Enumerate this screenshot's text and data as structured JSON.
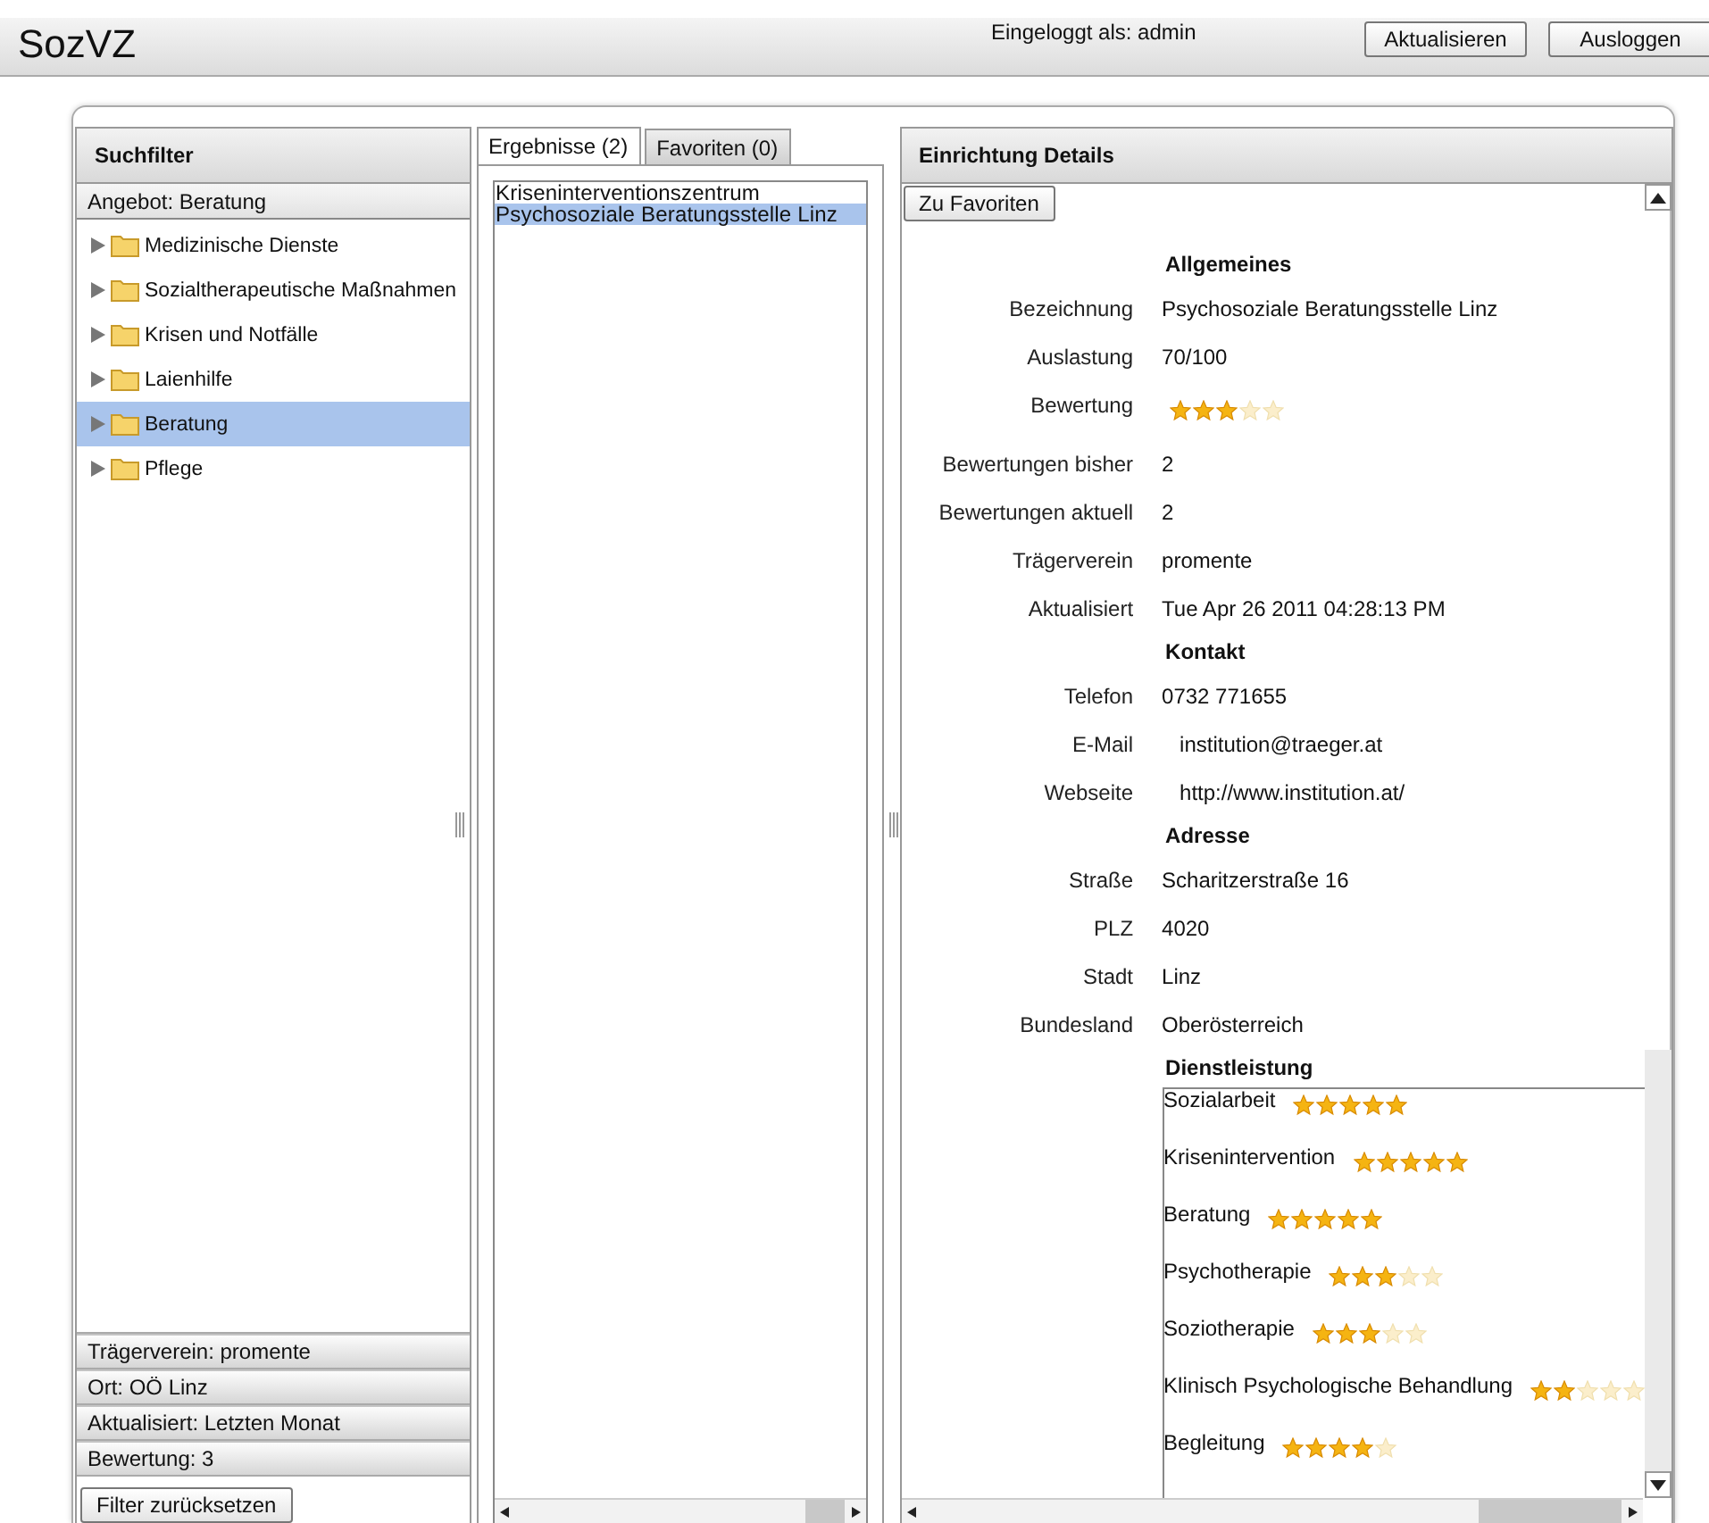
{
  "app": {
    "title": "SozVZ",
    "login_status": "Eingeloggt als: admin",
    "buttons": [
      {
        "label": "Aktualisieren"
      },
      {
        "label": "Ausloggen"
      }
    ]
  },
  "filter_panel": {
    "title": "Suchfilter",
    "sections": [
      {
        "label": "Angebot: Beratung",
        "expanded": true
      },
      {
        "label": "Trägerverein: promente",
        "expanded": false
      },
      {
        "label": "Ort: OÖ Linz",
        "expanded": false
      },
      {
        "label": "Aktualisiert: Letzten Monat",
        "expanded": false
      },
      {
        "label": "Bewertung: 3",
        "expanded": false
      }
    ],
    "tree": [
      {
        "label": "Medizinische Dienste",
        "selected": false
      },
      {
        "label": "Sozialtherapeutische Maßnahmen",
        "selected": false
      },
      {
        "label": "Krisen und Notfälle",
        "selected": false
      },
      {
        "label": "Laienhilfe",
        "selected": false
      },
      {
        "label": "Beratung",
        "selected": true
      },
      {
        "label": "Pflege",
        "selected": false
      }
    ],
    "reset_button": "Filter zurücksetzen"
  },
  "results_panel": {
    "tabs": [
      {
        "label": "Ergebnisse (2)",
        "selected": true
      },
      {
        "label": "Favoriten (0)",
        "selected": false
      }
    ],
    "results": [
      {
        "label": "Kriseninterventionszentrum",
        "selected": false
      },
      {
        "label": "Psychosoziale Beratungsstelle Linz",
        "selected": true
      }
    ]
  },
  "details": {
    "title": "Einrichtung Details",
    "favorite_button": "Zu Favoriten",
    "sections": [
      {
        "heading": "Allgemeines",
        "fields": [
          {
            "kind": "text",
            "label": "Bezeichnung",
            "value": "Psychosoziale Beratungsstelle Linz"
          },
          {
            "kind": "text",
            "label": "Auslastung",
            "value": "70/100"
          },
          {
            "kind": "stars",
            "label": "Bewertung",
            "stars": 3
          },
          {
            "kind": "text",
            "label": "Bewertungen bisher",
            "value": "2"
          },
          {
            "kind": "text",
            "label": "Bewertungen aktuell",
            "value": "2"
          },
          {
            "kind": "text",
            "label": "Trägerverein",
            "value": "promente"
          },
          {
            "kind": "text",
            "label": "Aktualisiert",
            "value": "Tue Apr 26 2011 04:28:13 PM"
          }
        ]
      },
      {
        "heading": "Kontakt",
        "fields": [
          {
            "kind": "text",
            "label": "Telefon",
            "value": "0732 771655"
          },
          {
            "kind": "link",
            "label": "E-Mail",
            "value": "institution@traeger.at"
          },
          {
            "kind": "link",
            "label": "Webseite",
            "value": "http://www.institution.at/"
          }
        ]
      },
      {
        "heading": "Adresse",
        "fields": [
          {
            "kind": "text",
            "label": "Straße",
            "value": "Scharitzerstraße 16"
          },
          {
            "kind": "text",
            "label": "PLZ",
            "value": "4020"
          },
          {
            "kind": "text",
            "label": "Stadt",
            "value": "Linz"
          },
          {
            "kind": "text",
            "label": "Bundesland",
            "value": "Oberösterreich"
          }
        ]
      }
    ],
    "services": {
      "heading": "Dienstleistung",
      "items": [
        {
          "name": "Sozialarbeit",
          "stars": 5
        },
        {
          "name": "Krisenintervention",
          "stars": 5
        },
        {
          "name": "Beratung",
          "stars": 5
        },
        {
          "name": "Psychotherapie",
          "stars": 3
        },
        {
          "name": "Soziotherapie",
          "stars": 3
        },
        {
          "name": "Klinisch Psychologische Behandlung",
          "stars": 2
        },
        {
          "name": "Begleitung",
          "stars": 4
        }
      ]
    }
  }
}
